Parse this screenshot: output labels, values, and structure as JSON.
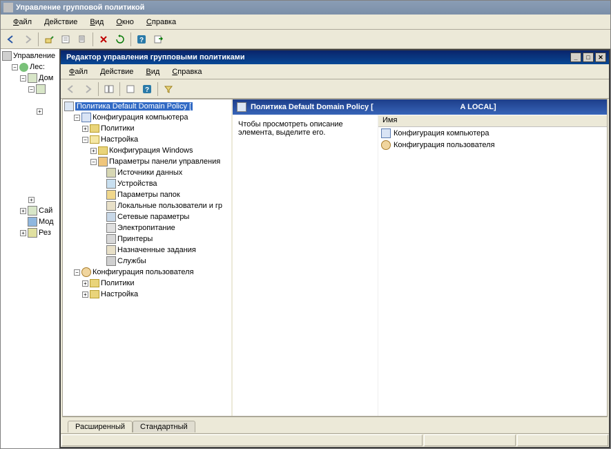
{
  "outer": {
    "title": "Управление групповой политикой",
    "menu": [
      "Файл",
      "Действие",
      "Вид",
      "Окно",
      "Справка"
    ]
  },
  "outer_tree": {
    "root": "Управление",
    "forest": "Лес:",
    "dom": "Дом",
    "sites": "Сай",
    "mod": "Мод",
    "res": "Рез"
  },
  "inner": {
    "title": "Редактор управления групповыми политиками",
    "menu": [
      "Файл",
      "Действие",
      "Вид",
      "Справка"
    ],
    "header": "Политика Default Domain Policy [",
    "header_tail": "A LOCAL]",
    "desc": "Чтобы просмотреть описание элемента, выделите его.",
    "name_col": "Имя",
    "comp_conf": "Конфигурация компьютера",
    "user_conf": "Конфигурация пользователя",
    "tabs": {
      "extended": "Расширенный",
      "standard": "Стандартный"
    }
  },
  "tree": {
    "root": "Политика Default Domain Policy [",
    "comp_conf": "Конфигурация компьютера",
    "policies": "Политики",
    "settings": "Настройка",
    "win_conf": "Конфигурация Windows",
    "cp_params": "Параметры панели управления",
    "datasources": "Источники данных",
    "devices": "Устройства",
    "folder_opts": "Параметры папок",
    "local_users": "Локальные пользователи и гр",
    "net_params": "Сетевые параметры",
    "power": "Электропитание",
    "printers": "Принтеры",
    "scheduled": "Назначенные задания",
    "services": "Службы",
    "user_conf": "Конфигурация пользователя"
  }
}
